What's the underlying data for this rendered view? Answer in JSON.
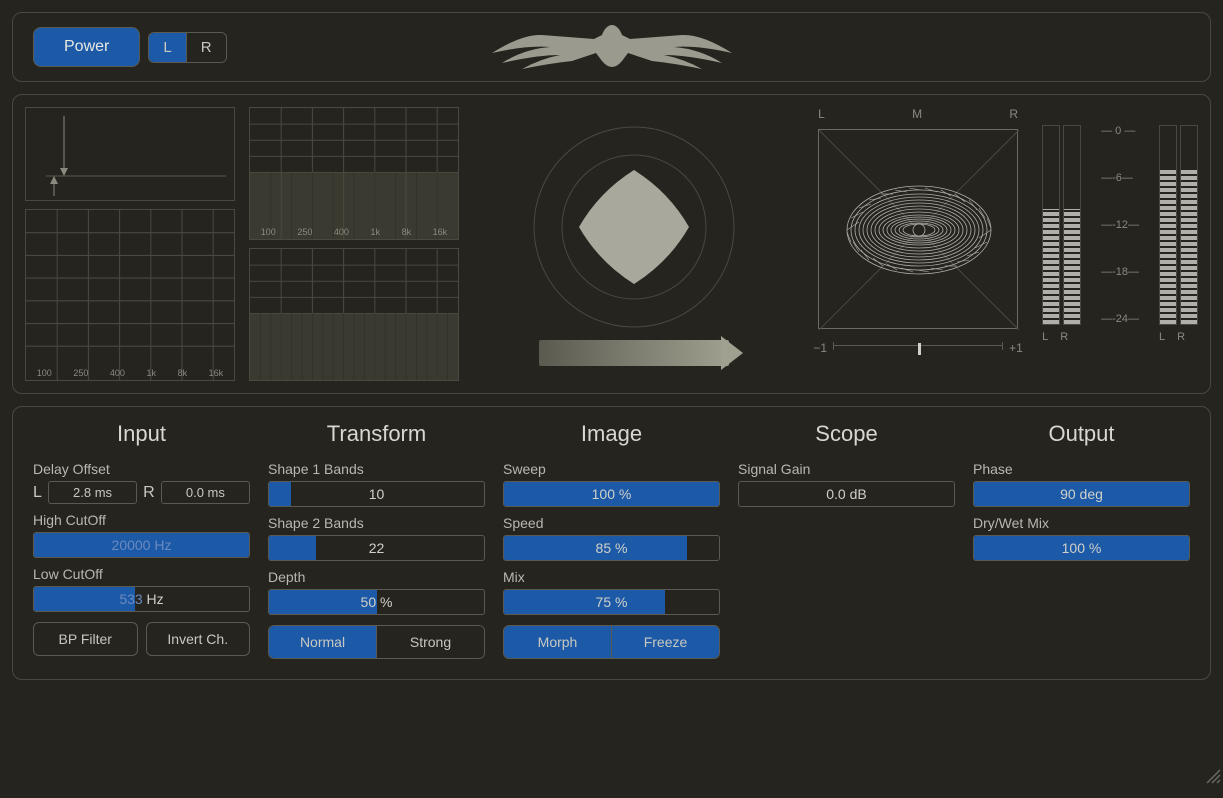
{
  "header": {
    "power_label": "Power",
    "ch_l_label": "L",
    "ch_r_label": "R",
    "l_active": true,
    "r_active": false
  },
  "viz": {
    "freq_labels": [
      "100",
      "250",
      "400",
      "1k",
      "8k",
      "16k"
    ],
    "scope": {
      "l_label": "L",
      "m_label": "M",
      "r_label": "R",
      "balance_min": "−1",
      "balance_max": "+1",
      "balance_pos": 0.5
    },
    "meter": {
      "scale": [
        "0",
        "-6",
        "-12",
        "-18",
        "-24"
      ],
      "left_pair_l": "L",
      "left_pair_r": "R",
      "right_pair_l": "L",
      "right_pair_r": "R",
      "in_l_pct": 58,
      "in_r_pct": 58,
      "out_l_pct": 78,
      "out_r_pct": 78
    }
  },
  "sections": {
    "input": {
      "title": "Input",
      "delay_offset_label": "Delay Offset",
      "delay_l_prefix": "L",
      "delay_l_value": "2.8 ms",
      "delay_r_prefix": "R",
      "delay_r_value": "0.0 ms",
      "high_cutoff_label": "High CutOff",
      "high_cutoff_value": "20000 Hz",
      "high_cutoff_pct": 100,
      "low_cutoff_label": "Low CutOff",
      "low_cutoff_value": "533 Hz",
      "low_cutoff_pct": 47,
      "bp_filter_label": "BP Filter",
      "invert_ch_label": "Invert Ch."
    },
    "transform": {
      "title": "Transform",
      "shape1_label": "Shape 1 Bands",
      "shape1_value": "10",
      "shape1_pct": 10,
      "shape2_label": "Shape 2 Bands",
      "shape2_value": "22",
      "shape2_pct": 22,
      "depth_label": "Depth",
      "depth_value": "50 %",
      "depth_pct": 50,
      "normal_label": "Normal",
      "strong_label": "Strong",
      "normal_active": true
    },
    "image": {
      "title": "Image",
      "sweep_label": "Sweep",
      "sweep_value": "100 %",
      "sweep_pct": 100,
      "speed_label": "Speed",
      "speed_value": "85 %",
      "speed_pct": 85,
      "mix_label": "Mix",
      "mix_value": "75 %",
      "mix_pct": 75,
      "morph_label": "Morph",
      "freeze_label": "Freeze",
      "morph_active": true,
      "freeze_active": true
    },
    "scope": {
      "title": "Scope",
      "signal_gain_label": "Signal Gain",
      "signal_gain_value": "0.0 dB",
      "signal_gain_pct": 50
    },
    "output": {
      "title": "Output",
      "phase_label": "Phase",
      "phase_value": "90 deg",
      "phase_pct": 100,
      "drywet_label": "Dry/Wet Mix",
      "drywet_value": "100 %",
      "drywet_pct": 100
    }
  }
}
